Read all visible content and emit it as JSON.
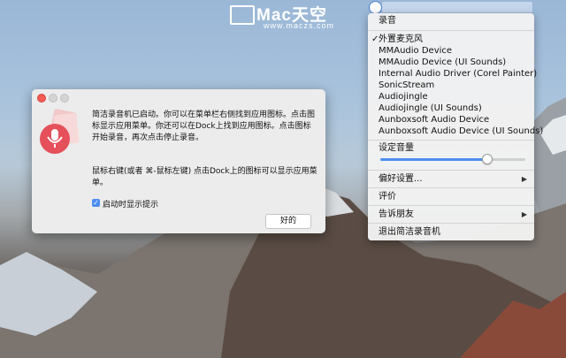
{
  "watermark": {
    "brand": "Mac天空",
    "url": "www.maczs.com"
  },
  "menu": {
    "header": "录音",
    "devices": [
      {
        "label": "外置麦克风",
        "checked": true
      },
      {
        "label": "MMAudio Device",
        "checked": false
      },
      {
        "label": "MMAudio Device (UI Sounds)",
        "checked": false
      },
      {
        "label": "Internal Audio Driver (Corel Painter)",
        "checked": false
      },
      {
        "label": "SonicStream",
        "checked": false
      },
      {
        "label": "Audiojingle",
        "checked": false
      },
      {
        "label": "Audiojingle (UI Sounds)",
        "checked": false
      },
      {
        "label": "Aunboxsoft Audio Device",
        "checked": false
      },
      {
        "label": "Aunboxsoft Audio Device (UI Sounds)",
        "checked": false
      }
    ],
    "volume_label": "设定音量",
    "volume_level": 0.73,
    "preferences": "偏好设置...",
    "rate": "评价",
    "tell_friends": "告诉朋友",
    "quit": "退出简洁录音机"
  },
  "dialog": {
    "paragraph1": "简洁录音机已启动。你可以在菜单栏右侧找到应用图标。点击图标显示应用菜单。你还可以在Dock上找到应用图标。点击图标开始录音，再次点击停止录音。",
    "paragraph2": "鼠标右键(或者 ⌘-鼠标左键) 点击Dock上的图标可以显示应用菜单。",
    "checkbox_label": "启动时显示提示",
    "checkbox_checked": true,
    "ok_button": "好的"
  }
}
